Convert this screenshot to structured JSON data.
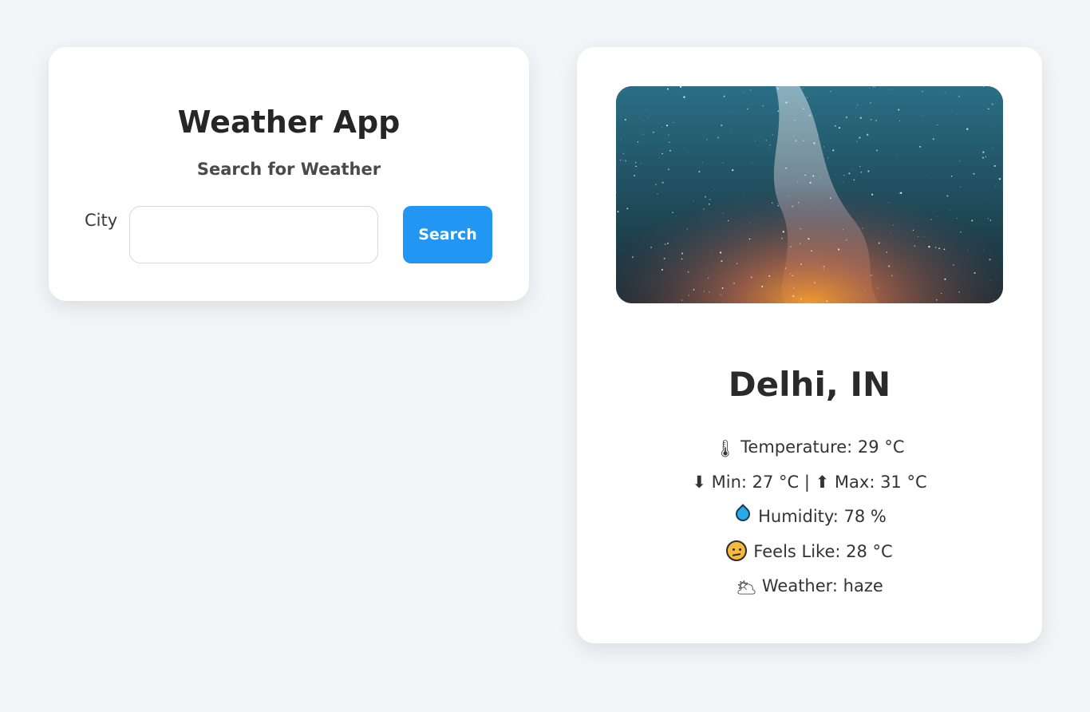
{
  "search_card": {
    "title": "Weather App",
    "subtitle": "Search for Weather",
    "city_label": "City",
    "city_input_value": "",
    "search_button_label": "Search"
  },
  "weather_card": {
    "image_icon": "starry-night-sky-photo",
    "location": "Delhi, IN",
    "details": [
      {
        "icon": "thermometer-icon",
        "glyph": "🌡",
        "text": "Temperature: 29 °C"
      },
      {
        "icon": "min-max-arrows-icon",
        "glyph": "",
        "text": "⬇ Min: 27 °C | ⬆ Max: 31 °C"
      },
      {
        "icon": "droplet-icon",
        "glyph": "",
        "text": "Humidity: 78 %"
      },
      {
        "icon": "thinking-face-icon",
        "glyph": "",
        "text": "Feels Like: 28 °C"
      },
      {
        "icon": "cloud-sun-icon",
        "glyph": "🌥",
        "text": "Weather: haze"
      }
    ]
  },
  "colors": {
    "background": "#f4f5f9",
    "card": "#ffffff",
    "accent": "#2196f3"
  }
}
